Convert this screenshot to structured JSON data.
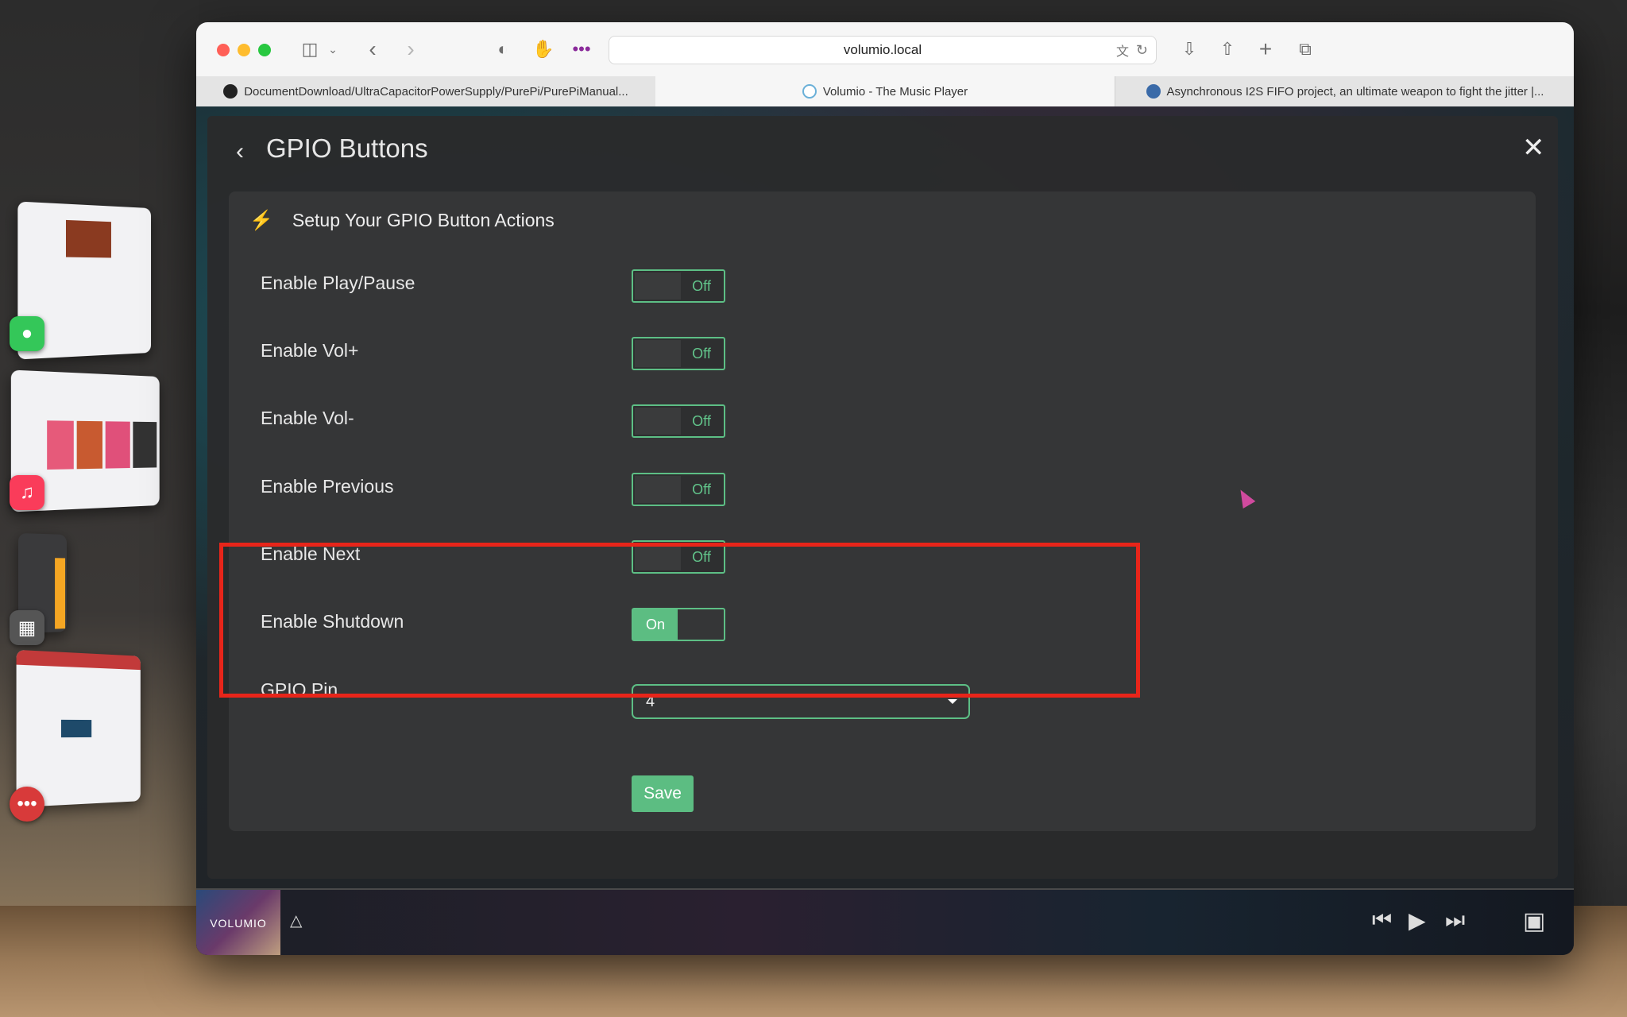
{
  "browser": {
    "url": "volumio.local",
    "tabs": [
      {
        "label": "DocumentDownload/UltraCapacitorPowerSupply/PurePi/PurePiManual..."
      },
      {
        "label": "Volumio - The Music Player"
      },
      {
        "label": "Asynchronous I2S FIFO project, an ultimate weapon to fight the jitter |..."
      }
    ]
  },
  "modal": {
    "title": "GPIO Buttons",
    "section_title": "Setup Your GPIO Button Actions",
    "rows": [
      {
        "label": "Enable Play/Pause",
        "state": "Off"
      },
      {
        "label": "Enable Vol+",
        "state": "Off"
      },
      {
        "label": "Enable Vol-",
        "state": "Off"
      },
      {
        "label": "Enable Previous",
        "state": "Off"
      },
      {
        "label": "Enable Next",
        "state": "Off"
      },
      {
        "label": "Enable Shutdown",
        "state": "On"
      }
    ],
    "gpio_pin": {
      "label": "GPIO Pin",
      "value": "4"
    },
    "save_label": "Save"
  },
  "player": {
    "album_label": "VOLUMIO"
  },
  "colors": {
    "accent": "#5cbd82",
    "highlight": "#e8251a"
  }
}
